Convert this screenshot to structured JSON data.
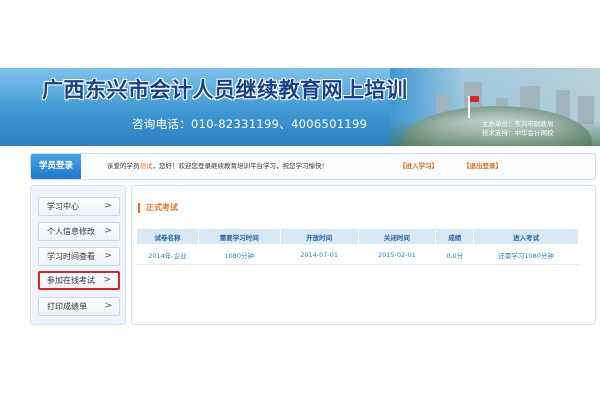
{
  "banner": {
    "title": "广西东兴市会计人员继续教育网上培训",
    "phone": "咨询电话：010-82331199、4006501199",
    "org_line1": "主办单位：东兴市财政局",
    "org_line2": "技术支持：中华会计网校"
  },
  "login_bar": {
    "tab_label": "学员登录",
    "greeting_prefix": "亲爱的学员",
    "username": "测试",
    "greeting_suffix": "，您好！欢迎您登录继续教育培训平台学习，祝您学习愉快！",
    "enter_label": "【进入学习】",
    "logout_label": "【退出登录】"
  },
  "sidebar": {
    "items": [
      {
        "label": "学习中心",
        "chevron": ">"
      },
      {
        "label": "个人信息修改",
        "chevron": ">"
      },
      {
        "label": "学习时间查看",
        "chevron": ">"
      },
      {
        "label": "参加在线考试",
        "chevron": ">"
      },
      {
        "label": "打印成绩单",
        "chevron": ">"
      }
    ],
    "active_index": 3
  },
  "main": {
    "section_title": "正式考试",
    "table": {
      "headers": [
        "试卷名称",
        "需要学习时间",
        "开放时间",
        "关闭时间",
        "成绩",
        "进入考试"
      ],
      "rows": [
        [
          "2014年-企业",
          "1080分钟",
          "2014-07-01",
          "2015-02-01",
          "0.0分",
          "还需学习1080分钟"
        ]
      ]
    }
  },
  "colors": {
    "banner_blue": "#3f97d2",
    "title_blue": "#16418a",
    "accent_orange": "#e0721f",
    "link_blue": "#2a7fc6",
    "active_outline": "#d2272b"
  }
}
